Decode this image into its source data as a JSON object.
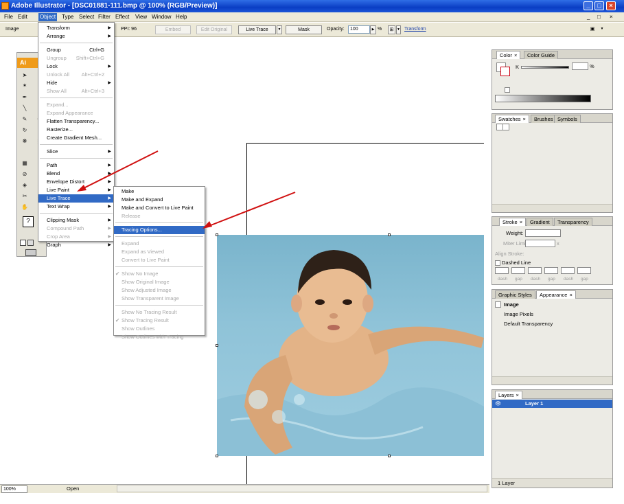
{
  "window": {
    "title": "Adobe Illustrator - [DSC01881-111.bmp @ 100% (RGB/Preview)]",
    "buttons": [
      "_",
      "□",
      "×"
    ]
  },
  "menubar": [
    "File",
    "Edit",
    "Object",
    "Type",
    "Select",
    "Filter",
    "Effect",
    "View",
    "Window",
    "Help"
  ],
  "menubar_right": [
    "_",
    "□",
    "×"
  ],
  "controlbar": {
    "selection_label": "Image",
    "ppi_label": "PPI: 96",
    "embed": "Embed",
    "edit_original": "Edit Original",
    "live_trace": "Live Trace",
    "mask": "Mask",
    "opacity_label": "Opacity:",
    "opacity_value": "100",
    "opacity_unit": "%",
    "transform": "Transform"
  },
  "tools": {
    "logo": "Ai"
  },
  "object_menu": [
    {
      "label": "Transform",
      "arrow": true
    },
    {
      "label": "Arrange",
      "arrow": true
    },
    {
      "sep": true
    },
    {
      "label": "Group",
      "shortcut": "Ctrl+G"
    },
    {
      "label": "Ungroup",
      "shortcut": "Shift+Ctrl+G",
      "disabled": true
    },
    {
      "label": "Lock",
      "arrow": true
    },
    {
      "label": "Unlock All",
      "shortcut": "Alt+Ctrl+2",
      "disabled": true
    },
    {
      "label": "Hide",
      "arrow": true
    },
    {
      "label": "Show All",
      "shortcut": "Alt+Ctrl+3",
      "disabled": true
    },
    {
      "sep": true
    },
    {
      "label": "Expand...",
      "disabled": true
    },
    {
      "label": "Expand Appearance",
      "disabled": true
    },
    {
      "label": "Flatten Transparency..."
    },
    {
      "label": "Rasterize..."
    },
    {
      "label": "Create Gradient Mesh..."
    },
    {
      "sep": true
    },
    {
      "label": "Slice",
      "arrow": true
    },
    {
      "sep": true
    },
    {
      "label": "Path",
      "arrow": true
    },
    {
      "label": "Blend",
      "arrow": true
    },
    {
      "label": "Envelope Distort",
      "arrow": true
    },
    {
      "label": "Live Paint",
      "arrow": true
    },
    {
      "label": "Live Trace",
      "arrow": true,
      "highlighted": true
    },
    {
      "label": "Text Wrap",
      "arrow": true
    },
    {
      "sep": true
    },
    {
      "label": "Clipping Mask",
      "arrow": true
    },
    {
      "label": "Compound Path",
      "arrow": true,
      "disabled": true
    },
    {
      "label": "Crop Area",
      "arrow": true,
      "disabled": true
    },
    {
      "label": "Graph",
      "arrow": true
    }
  ],
  "live_trace_menu": [
    {
      "label": "Make"
    },
    {
      "label": "Make and Expand"
    },
    {
      "label": "Make and Convert to Live Paint"
    },
    {
      "label": "Release",
      "disabled": true
    },
    {
      "sep": true
    },
    {
      "label": "Tracing Options...",
      "highlighted": true
    },
    {
      "sep": true
    },
    {
      "label": "Expand",
      "disabled": true
    },
    {
      "label": "Expand as Viewed",
      "disabled": true
    },
    {
      "label": "Convert to Live Paint",
      "disabled": true
    },
    {
      "sep": true
    },
    {
      "label": "Show No Image",
      "disabled": true,
      "checked": true
    },
    {
      "label": "Show Original Image",
      "disabled": true
    },
    {
      "label": "Show Adjusted Image",
      "disabled": true
    },
    {
      "label": "Show Transparent Image",
      "disabled": true
    },
    {
      "sep": true
    },
    {
      "label": "Show No Tracing Result",
      "disabled": true
    },
    {
      "label": "Show Tracing Result",
      "disabled": true,
      "checked": true
    },
    {
      "label": "Show Outlines",
      "disabled": true
    },
    {
      "label": "Show Outlines with Tracing",
      "disabled": true
    }
  ],
  "panels": {
    "color": {
      "tabs": [
        "Color",
        "Color Guide"
      ],
      "channel": "K",
      "unit": "%"
    },
    "swatches": {
      "tabs": [
        "Swatches",
        "Brushes",
        "Symbols"
      ]
    },
    "stroke": {
      "tabs": [
        "Stroke",
        "Gradient",
        "Transparency"
      ],
      "weight": "Weight:",
      "miter": "Miter Limit:",
      "miter_x": "x",
      "align": "Align Stroke:",
      "dashed": "Dashed Line",
      "dash_labels": [
        "dash",
        "gap",
        "dash",
        "gap",
        "dash",
        "gap"
      ]
    },
    "appearance": {
      "tabs": [
        "Graphic Styles",
        "Appearance"
      ],
      "rows": [
        "Image",
        "Image Pixels",
        "Default Transparency"
      ]
    },
    "layers": {
      "tabs": [
        "Layers"
      ],
      "layer": "Layer 1",
      "footer": "1 Layer"
    }
  },
  "statusbar": {
    "zoom": "100%",
    "status": "Open"
  },
  "colors": {
    "highlight": "#316ac5",
    "titlebar": "#0a3ec4",
    "chrome": "#ece9d8",
    "arrow": "#d01010"
  }
}
